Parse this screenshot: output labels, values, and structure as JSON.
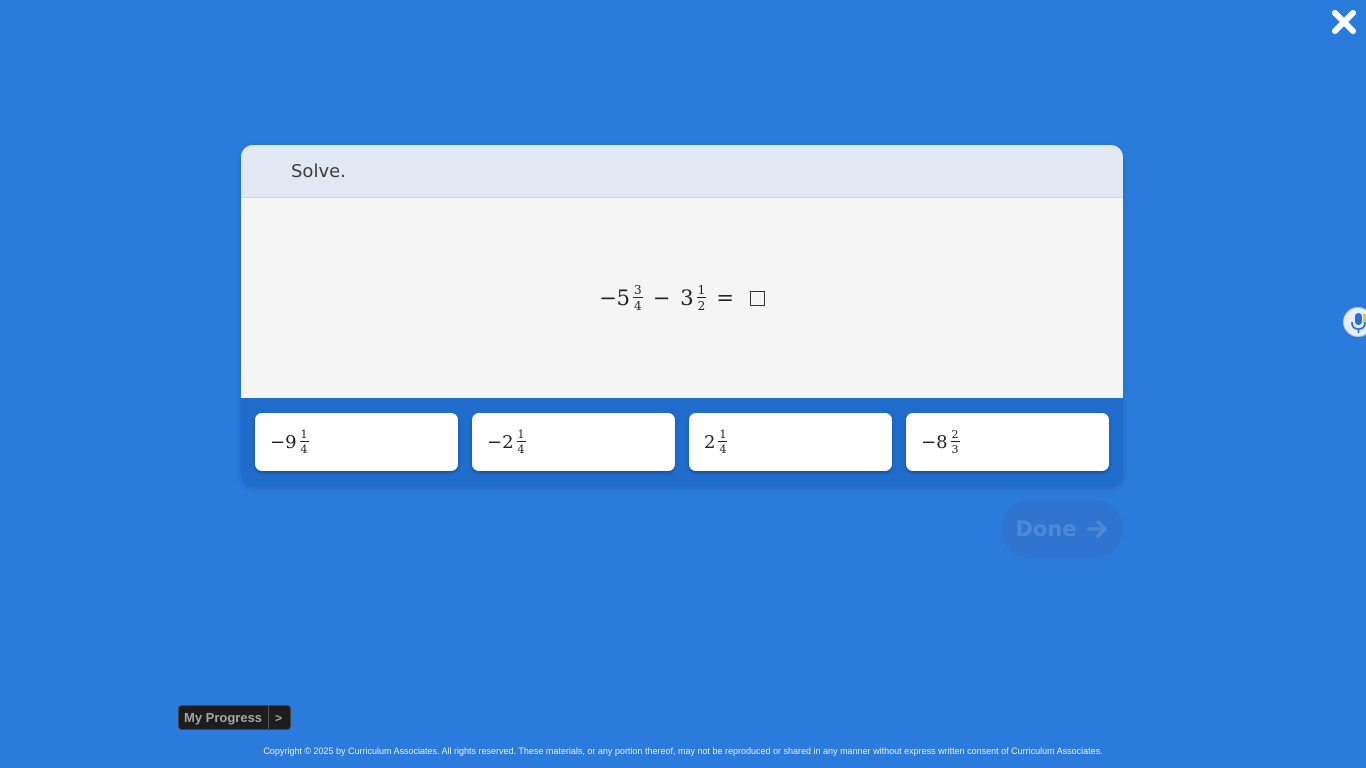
{
  "question": {
    "prompt": "Solve.",
    "equation": {
      "term1": {
        "sign": "−",
        "whole": "5",
        "num": "3",
        "den": "4"
      },
      "operator": "−",
      "term2": {
        "whole": "3",
        "num": "1",
        "den": "2"
      },
      "equals": "="
    }
  },
  "answers": [
    {
      "sign": "−",
      "whole": "9",
      "num": "1",
      "den": "4"
    },
    {
      "sign": "−",
      "whole": "2",
      "num": "1",
      "den": "4"
    },
    {
      "sign": "",
      "whole": "2",
      "num": "1",
      "den": "4"
    },
    {
      "sign": "−",
      "whole": "8",
      "num": "2",
      "den": "3"
    }
  ],
  "done_button": {
    "label": "Done"
  },
  "progress_button": {
    "label": "My Progress",
    "arrow": ">"
  },
  "footer": {
    "copyright": "Copyright © 2025 by Curriculum Associates. All rights reserved. These materials, or any portion thereof, may not be reproduced or shared in any manner without express written consent of Curriculum Associates."
  },
  "icons": {
    "close": "close-icon",
    "microphone": "microphone-icon",
    "arrow": "arrow-right-icon"
  },
  "colors": {
    "background": "#2a7bdc",
    "done_disabled": "#2f75cf"
  }
}
